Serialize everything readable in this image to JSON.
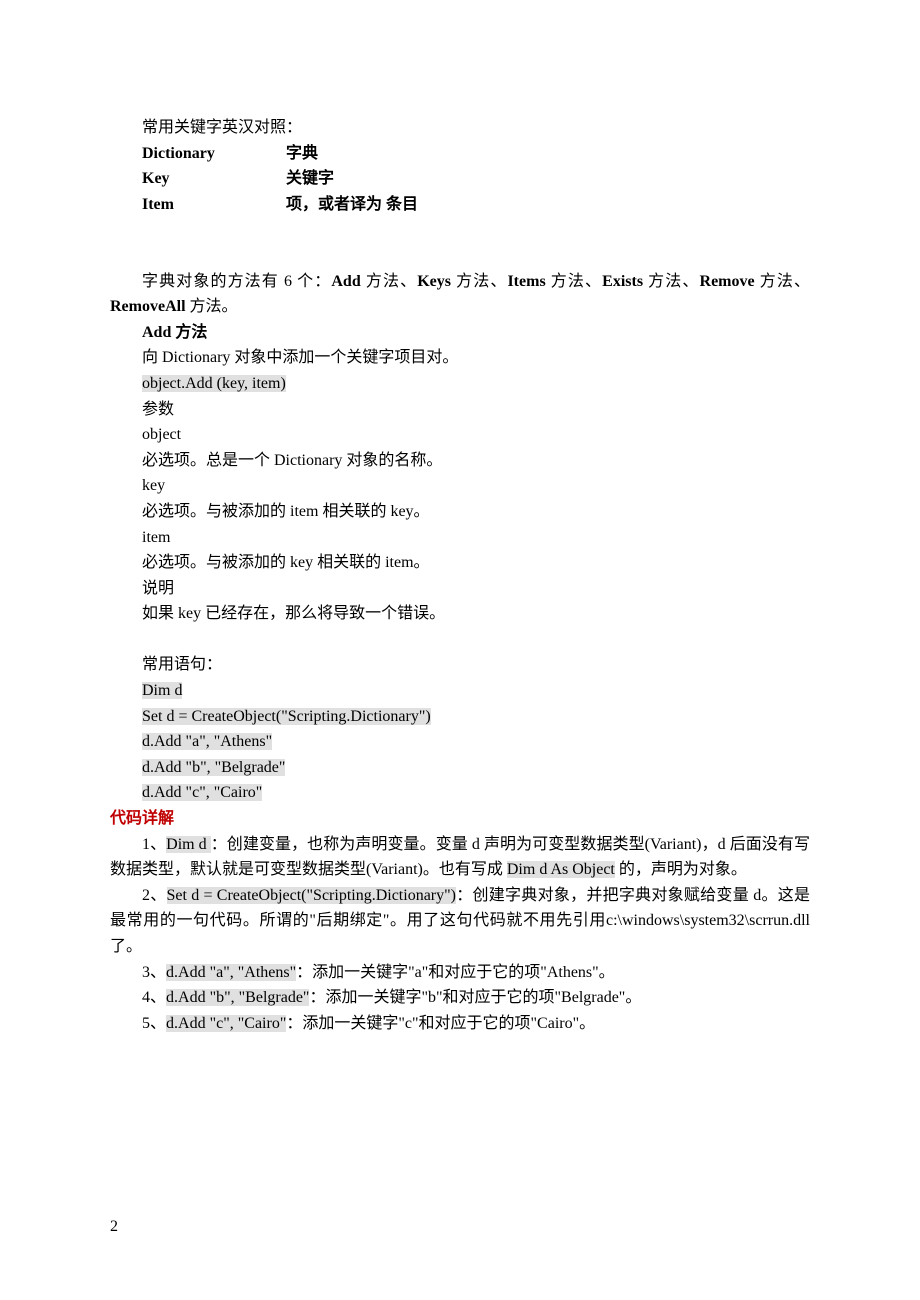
{
  "glossary": {
    "heading": "常用关键字英汉对照：",
    "rows": [
      {
        "term": "Dictionary",
        "def": "字典"
      },
      {
        "term": "Key",
        "def": "关键字"
      },
      {
        "term": "Item",
        "def": "项，或者译为 条目"
      }
    ]
  },
  "methods_intro": {
    "p1_a": "字典对象的方法有 6 个：",
    "p1_b": "Add",
    "p1_c": " 方法、",
    "p1_d": "Keys",
    "p1_e": " 方法、",
    "p1_f": "Items",
    "p1_g": " 方法、",
    "p1_h": "Exists",
    "p1_i": " 方法、",
    "p1_j": "Remove",
    "p1_k": " 方法、",
    "p1_l": "RemoveAll",
    "p1_m": " 方法。"
  },
  "add_method": {
    "title": "Add 方法",
    "desc": "向 Dictionary 对象中添加一个关键字项目对。",
    "syntax": "object.Add (key, item)",
    "params_label": "参数",
    "object_label": "object",
    "object_desc": "必选项。总是一个 Dictionary 对象的名称。",
    "key_label": "key",
    "key_desc": "必选项。与被添加的 item 相关联的 key。",
    "item_label": "item",
    "item_desc": "必选项。与被添加的 key 相关联的 item。",
    "note_label": "说明",
    "note_desc": "如果 key 已经存在，那么将导致一个错误。"
  },
  "usage": {
    "heading": "常用语句：",
    "lines": [
      "Dim d",
      "Set d = CreateObject(\"Scripting.Dictionary\")",
      "d.Add \"a\", \"Athens\"",
      "d.Add \"b\", \"Belgrade\"",
      "d.Add \"c\", \"Cairo\""
    ]
  },
  "detail": {
    "heading": "代码详解",
    "item1_a": "1、",
    "item1_b": "Dim d ",
    "item1_c": "：创建变量，也称为声明变量。变量 d 声明为可变型数据类型(Variant)，d 后面没有写数据类型，默认就是可变型数据类型(Variant)。也有写成 ",
    "item1_d": "Dim d As Object",
    "item1_e": " 的，声明为对象。",
    "item2_a": "2、",
    "item2_b": "Set d = CreateObject(\"Scripting.Dictionary\")",
    "item2_c": "：创建字典对象，并把字典对象赋给变量 d。这是最常用的一句代码。所谓的\"后期绑定\"。用了这句代码就不用先引用c:\\windows\\system32\\scrrun.dll 了。",
    "item3_a": "3、",
    "item3_b": "d.Add \"a\", \"Athens\"",
    "item3_c": "：添加一关键字\"a\"和对应于它的项\"Athens\"。",
    "item4_a": "4、",
    "item4_b": "d.Add \"b\", \"Belgrade\"",
    "item4_c": "：添加一关键字\"b\"和对应于它的项\"Belgrade\"。",
    "item5_a": "5、",
    "item5_b": "d.Add \"c\", \"Cairo\"",
    "item5_c": "：添加一关键字\"c\"和对应于它的项\"Cairo\"。"
  },
  "page_number": "2"
}
